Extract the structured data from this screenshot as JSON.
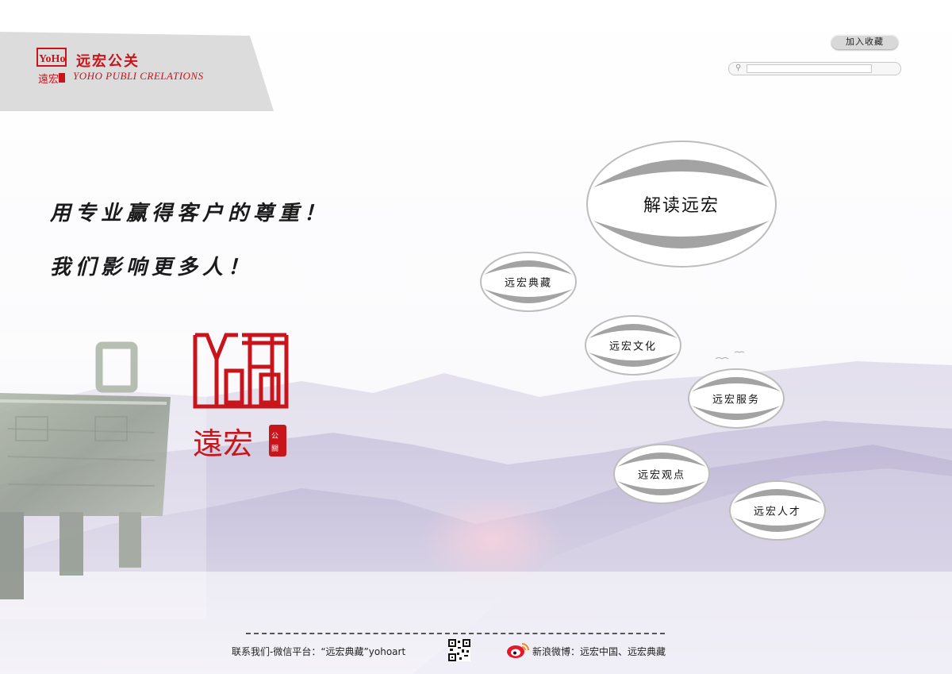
{
  "brand": {
    "name_cn": "远宏公关",
    "name_en": "YOHO PUBLI CRELATIONS"
  },
  "header": {
    "favorite_label": "加入收藏",
    "search": {
      "value": "",
      "placeholder": ""
    }
  },
  "slogans": [
    "用专业赢得客户的尊重！",
    "我们影响更多人！"
  ],
  "nav": {
    "main": "解读远宏",
    "items": [
      "远宏典藏",
      "远宏文化",
      "远宏服务",
      "远宏观点",
      "远宏人才"
    ]
  },
  "footer": {
    "contact": "联系我们-微信平台：“远宏典藏”yohoart",
    "weibo": "新浪微博：远宏中国、远宏典藏"
  },
  "colors": {
    "brand_red": "#c8151c",
    "ellipse_gray": "#9a9a9a",
    "mountain": "#cfc9e0"
  },
  "icons": {
    "search": "magnifier-icon",
    "weibo": "weibo-icon",
    "qr": "qr-code-icon"
  }
}
